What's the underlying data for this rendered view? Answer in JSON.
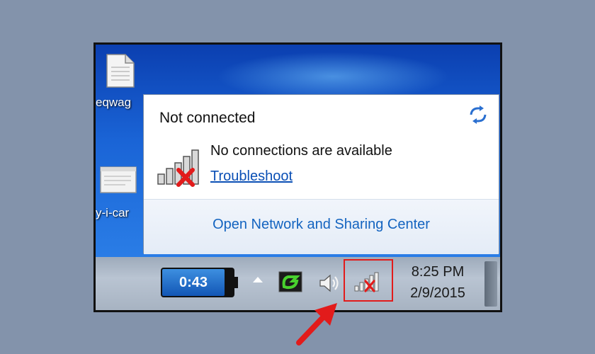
{
  "desktop": {
    "icons": [
      {
        "label": "eqwag"
      },
      {
        "label": "y-i-car"
      }
    ]
  },
  "popup": {
    "title": "Not connected",
    "message": "No connections are available",
    "troubleshoot_link": "Troubleshoot",
    "open_center_link": "Open Network and Sharing Center"
  },
  "taskbar": {
    "battery_time": "0:43",
    "clock_time": "8:25 PM",
    "clock_date": "2/9/2015"
  },
  "colors": {
    "accent_link": "#0a4fb5",
    "highlight": "#e21b1b",
    "no_connection_x": "#e21b1b"
  }
}
